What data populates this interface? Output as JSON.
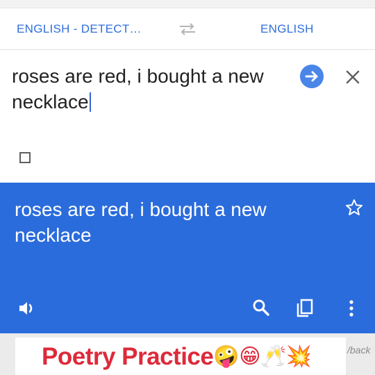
{
  "language_bar": {
    "source_language": "ENGLISH - DETECT…",
    "target_language": "ENGLISH",
    "swap_icon": "swap-arrows-icon"
  },
  "input": {
    "text": "roses are red, i bought a new necklace",
    "go_icon": "arrow-right-icon",
    "clear_icon": "close-icon",
    "handwriting_icon": "square-outline-icon"
  },
  "result": {
    "text": "roses are red, i bought a new necklace",
    "favorite_icon": "star-outline-icon",
    "speak_icon": "speaker-icon",
    "search_icon": "search-icon",
    "copy_icon": "copy-icon",
    "more_icon": "more-vertical-icon"
  },
  "overlay": {
    "caption": "Poetry Practice",
    "emojis": [
      "🤪",
      "😁",
      "🥂",
      "💥"
    ],
    "feedback_label": "/back"
  },
  "colors": {
    "accent_blue": "#2b6cdc",
    "link_blue": "#2f6fdc",
    "go_button_blue": "#4a86e8",
    "caption_red": "#dd2a3a"
  }
}
